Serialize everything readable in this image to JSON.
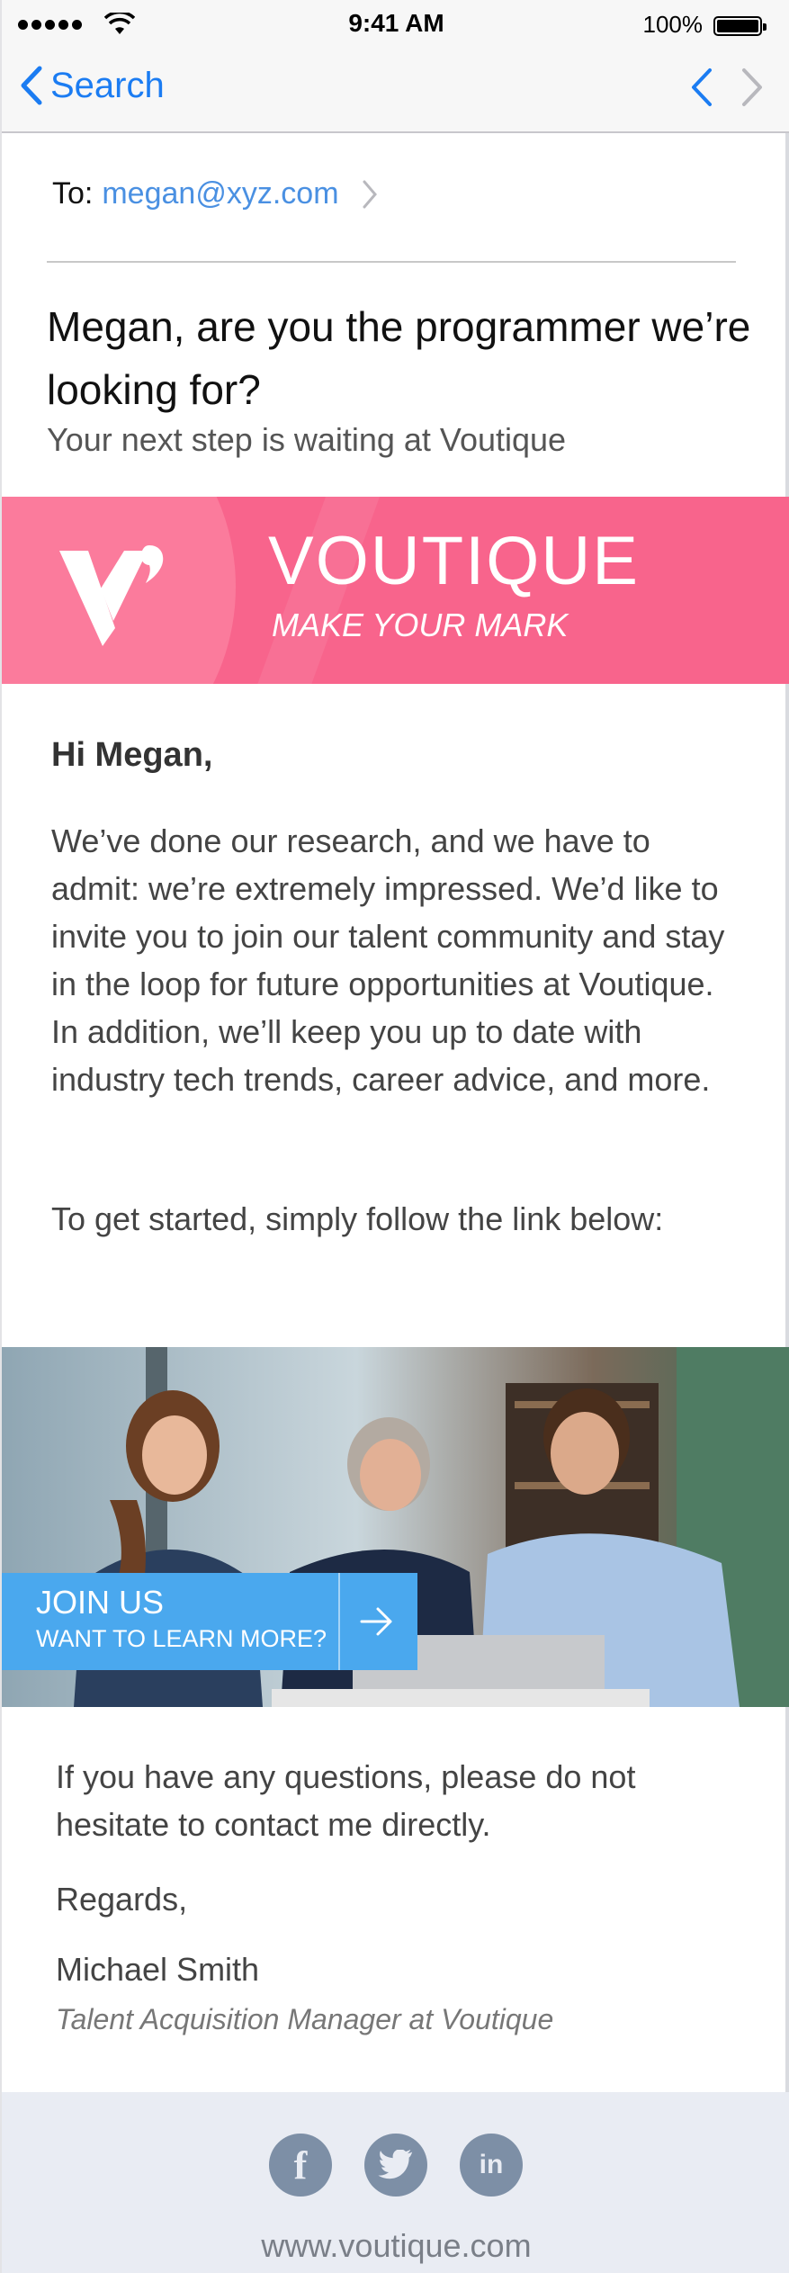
{
  "status_bar": {
    "time": "9:41 AM",
    "battery": "100%"
  },
  "nav": {
    "back_label": "Search"
  },
  "email": {
    "to_label": "To:",
    "to_address": "megan@xyz.com",
    "subject": "Megan, are you the programmer we’re looking for?",
    "preheader": "Your next step is waiting at Voutique"
  },
  "banner": {
    "brand": "VOUTIQUE",
    "tagline": "MAKE YOUR MARK",
    "bg_color": "#f8648c"
  },
  "body": {
    "greeting": "Hi Megan,",
    "paragraph1": "We’ve done our research, and we have to admit: we’re extremely impressed.  We’d like to invite you to join our talent community and stay in the loop for future opportunities at Voutique. In addition, we’ll keep you up to date with industry tech trends, career advice, and more.",
    "paragraph2": "To get started, simply follow the link below:"
  },
  "cta": {
    "title": "JOIN US",
    "subtitle": "WANT TO LEARN MORE?",
    "icon": "arrow-right-icon",
    "color": "#4aa8ee"
  },
  "closing": {
    "paragraph": "If you have any questions, please do not hesitate to contact me directly.",
    "regards": "Regards,",
    "name": "Michael Smith",
    "title": "Talent Acquisition Manager at Voutique"
  },
  "footer": {
    "social": [
      {
        "icon": "facebook-icon",
        "glyph": "f"
      },
      {
        "icon": "twitter-icon",
        "glyph": ""
      },
      {
        "icon": "linkedin-icon",
        "glyph": "in"
      }
    ],
    "website": "www.voutique.com"
  }
}
